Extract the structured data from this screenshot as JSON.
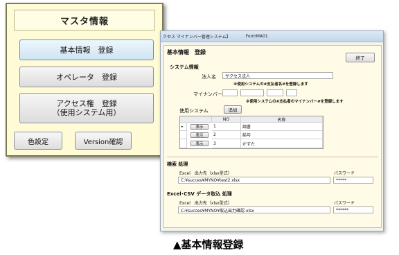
{
  "menu": {
    "title": "マスタ情報",
    "buttons": [
      {
        "line1": "基本情報　登録",
        "line2": ""
      },
      {
        "line1": "オペレータ　登録",
        "line2": ""
      },
      {
        "line1": "アクセス権　登録",
        "line2": "（使用システム用）"
      }
    ],
    "color_button": "色設定",
    "version_button": "Version確認"
  },
  "window": {
    "title_app": "クセス マイナンバー管理システム】",
    "title_form": "FormMA01",
    "header": "基本情報　登録",
    "close_button": "終了",
    "system_section": "システム情報",
    "corp_label": "法人名",
    "corp_value": "サクセス法人",
    "corp_note": "※使用システムの#支払者名#を登録します",
    "mynumber_label": "マイナンバー",
    "mynumber_note": "※使用システムの#支払者のマイナンバー#を登録します",
    "use_system_label": "使用システム",
    "add_button": "追加",
    "grid": {
      "headers": [
        "NO",
        "名称"
      ],
      "row_marker": "▸",
      "rows": [
        {
          "button": "表示",
          "no": "1",
          "name": "調書"
        },
        {
          "button": "表示",
          "no": "2",
          "name": "給与"
        },
        {
          "button": "表示",
          "no": "3",
          "name": "かすた"
        }
      ]
    },
    "search_section": "検索 処理",
    "excel_out_label": "Excel　出力先（xlsx型式）",
    "excel_out_path": "C:¥succes¥MYNO¥test2.xlsx",
    "password_label": "パスワード",
    "password_value": "*****",
    "csv_section": "Excel･CSV データ取込 処理",
    "excel_out_label2": "Excel　出力先（xlsx型式）",
    "excel_out_path2": "C:¥succes¥MYNO¥取込出力確認.xlsx",
    "password_label2": "パスワード",
    "password_value2": "******"
  },
  "caption": "▲基本情報登録"
}
